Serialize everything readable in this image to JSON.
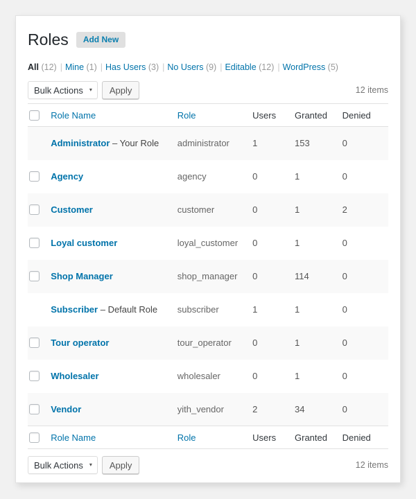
{
  "header": {
    "title": "Roles",
    "add_new_label": "Add New"
  },
  "filters": [
    {
      "label": "All",
      "count": "(12)",
      "current": true
    },
    {
      "label": "Mine",
      "count": "(1)",
      "current": false
    },
    {
      "label": "Has Users",
      "count": "(3)",
      "current": false
    },
    {
      "label": "No Users",
      "count": "(9)",
      "current": false
    },
    {
      "label": "Editable",
      "count": "(12)",
      "current": false
    },
    {
      "label": "WordPress",
      "count": "(5)",
      "current": false
    }
  ],
  "separator": "|",
  "tablenav": {
    "bulk_actions_label": "Bulk Actions",
    "caret": "▾",
    "apply_label": "Apply",
    "items_count": "12 items"
  },
  "columns": {
    "name": "Role Name",
    "role": "Role",
    "users": "Users",
    "granted": "Granted",
    "denied": "Denied"
  },
  "rows": [
    {
      "name": "Administrator",
      "suffix": " – Your Role",
      "slug": "administrator",
      "users": "1",
      "granted": "153",
      "denied": "0",
      "checkbox": false
    },
    {
      "name": "Agency",
      "suffix": "",
      "slug": "agency",
      "users": "0",
      "granted": "1",
      "denied": "0",
      "checkbox": true
    },
    {
      "name": "Customer",
      "suffix": "",
      "slug": "customer",
      "users": "0",
      "granted": "1",
      "denied": "2",
      "checkbox": true
    },
    {
      "name": "Loyal customer",
      "suffix": "",
      "slug": "loyal_customer",
      "users": "0",
      "granted": "1",
      "denied": "0",
      "checkbox": true
    },
    {
      "name": "Shop Manager",
      "suffix": "",
      "slug": "shop_manager",
      "users": "0",
      "granted": "114",
      "denied": "0",
      "checkbox": true
    },
    {
      "name": "Subscriber",
      "suffix": " – Default Role",
      "slug": "subscriber",
      "users": "1",
      "granted": "1",
      "denied": "0",
      "checkbox": false
    },
    {
      "name": "Tour operator",
      "suffix": "",
      "slug": "tour_operator",
      "users": "0",
      "granted": "1",
      "denied": "0",
      "checkbox": true
    },
    {
      "name": "Wholesaler",
      "suffix": "",
      "slug": "wholesaler",
      "users": "0",
      "granted": "1",
      "denied": "0",
      "checkbox": true
    },
    {
      "name": "Vendor",
      "suffix": "",
      "slug": "yith_vendor",
      "users": "2",
      "granted": "34",
      "denied": "0",
      "checkbox": true
    }
  ],
  "colors": {
    "link": "#0073aa",
    "page_bg": "#f1f1f1",
    "panel_bg": "#ffffff",
    "row_alt_bg": "#f9f9f9",
    "border": "#e1e1e1"
  }
}
